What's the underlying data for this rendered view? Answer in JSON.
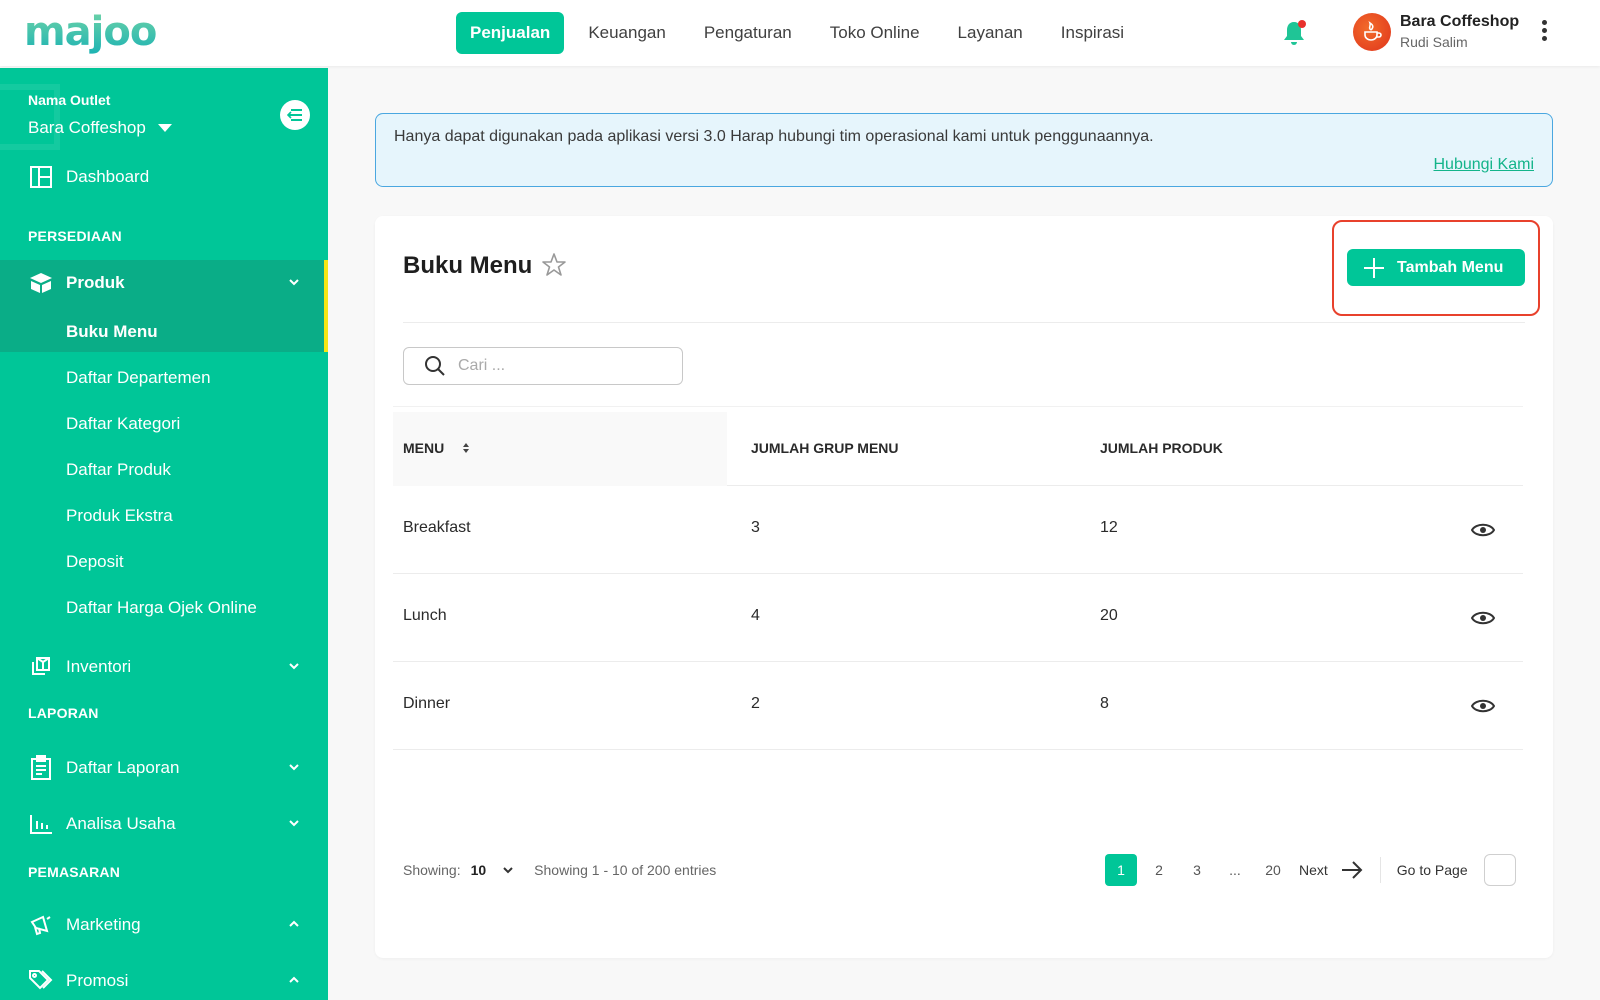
{
  "app": {
    "logo_text": "majoo",
    "brand_color": "#00c698",
    "highlight_color": "#e8412c"
  },
  "topnav": {
    "items": [
      {
        "label": "Penjualan",
        "active": true
      },
      {
        "label": "Keuangan"
      },
      {
        "label": "Pengaturan"
      },
      {
        "label": "Toko Online"
      },
      {
        "label": "Layanan"
      },
      {
        "label": "Inspirasi"
      }
    ],
    "notification_icon": "bell-icon",
    "profile": {
      "business_name": "Bara Coffeshop",
      "user_name": "Rudi Salim"
    }
  },
  "sidebar": {
    "outlet_label": "Nama Outlet",
    "outlet_name": "Bara Coffeshop",
    "dashboard": "Dashboard",
    "sections": {
      "persediaan": "PERSEDIAAN",
      "laporan": "LAPORAN",
      "pemasaran": "PEMASARAN"
    },
    "produk": "Produk",
    "produk_sub": [
      {
        "label": "Buku Menu",
        "active": true
      },
      {
        "label": "Daftar Departemen"
      },
      {
        "label": "Daftar Kategori"
      },
      {
        "label": "Daftar Produk"
      },
      {
        "label": "Produk Ekstra"
      },
      {
        "label": "Deposit"
      },
      {
        "label": "Daftar Harga Ojek Online"
      }
    ],
    "inventori": "Inventori",
    "daftar_laporan": "Daftar Laporan",
    "analisa_usaha": "Analisa Usaha",
    "marketing": "Marketing",
    "promosi": "Promosi"
  },
  "alert": {
    "message": "Hanya dapat digunakan pada aplikasi versi 3.0 Harap hubungi tim operasional kami untuk penggunaannya.",
    "link": "Hubungi Kami"
  },
  "page": {
    "title": "Buku Menu",
    "add_button": "Tambah Menu",
    "search_placeholder": "Cari ...",
    "search_value": ""
  },
  "table": {
    "headers": [
      "MENU",
      "JUMLAH GRUP MENU",
      "JUMLAH PRODUK"
    ],
    "rows": [
      {
        "menu": "Breakfast",
        "groups": "3",
        "products": "12"
      },
      {
        "menu": "Lunch",
        "groups": "4",
        "products": "20"
      },
      {
        "menu": "Dinner",
        "groups": "2",
        "products": "8"
      }
    ]
  },
  "pagination": {
    "showing_label": "Showing:",
    "per_page": "10",
    "summary": "Showing 1 - 10 of 200 entries",
    "pages": [
      "1",
      "2",
      "3",
      "...",
      "20"
    ],
    "current_page": "1",
    "next_label": "Next",
    "goto_label": "Go to Page",
    "goto_value": ""
  }
}
